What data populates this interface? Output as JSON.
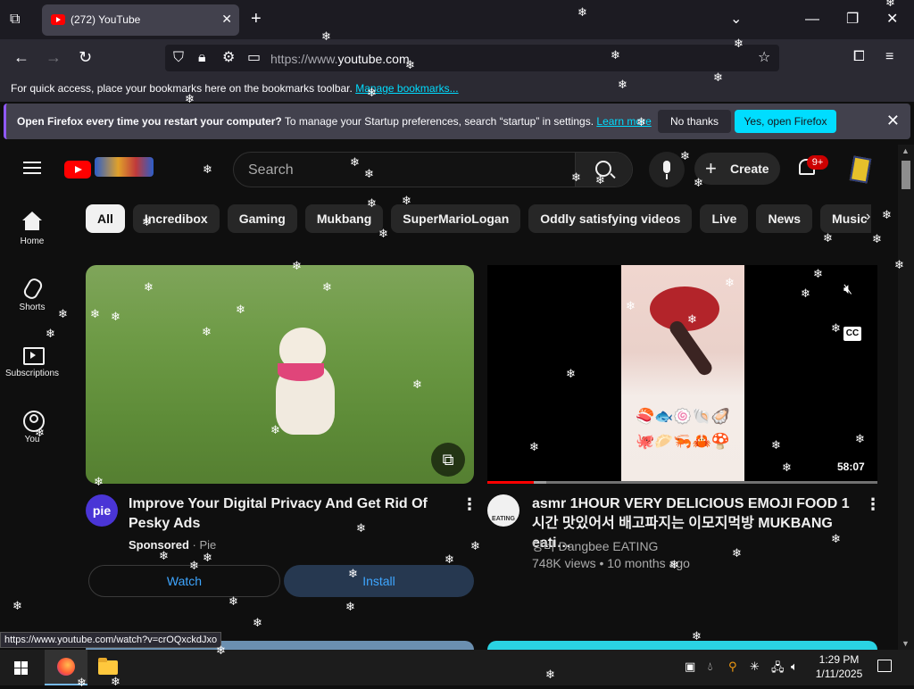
{
  "browser": {
    "tab_title": "(272) YouTube",
    "url_scheme": "https://www.",
    "url_host": "youtube.com",
    "bookmarks_message": "For quick access, place your bookmarks here on the bookmarks toolbar.",
    "manage_bookmarks": "Manage bookmarks...",
    "notification": {
      "bold": "Open Firefox every time you restart your computer?",
      "text": " To manage your Startup preferences, search “startup” in settings.",
      "learn_more": "Learn more",
      "no_thanks": "No thanks",
      "yes_open": "Yes, open Firefox"
    },
    "status_url": "https://www.youtube.com/watch?v=crOQxckdJxo"
  },
  "youtube": {
    "search_placeholder": "Search",
    "create_label": "Create",
    "notification_count": "9+",
    "sidebar": [
      {
        "label": "Home"
      },
      {
        "label": "Shorts"
      },
      {
        "label": "Subscriptions"
      },
      {
        "label": "You"
      }
    ],
    "chips": [
      "All",
      "Incredibox",
      "Gaming",
      "Mukbang",
      "SuperMarioLogan",
      "Oddly satisfying videos",
      "Live",
      "News",
      "Music"
    ],
    "ad": {
      "avatar_text": "pie",
      "title": "Improve Your Digital Privacy And Get Rid Of Pesky Ads",
      "sponsored": "Sponsored",
      "advertiser": "Pie",
      "watch_label": "Watch",
      "install_label": "Install"
    },
    "video": {
      "avatar_text": "EATING",
      "title": "asmr 1HOUR VERY DELICIOUS EMOJI FOOD 1시간 맛있어서 배고파지는 이모지먹방 MUKBANG eati…",
      "channel": "당비 Dangbee EATING",
      "views": "748K views",
      "age": "10 months ago",
      "duration": "58:07",
      "cc_label": "CC",
      "emoji_row1": "🍣🐟🍥🐚🦪",
      "emoji_row2": "🐙🥟🦐🦀🍄",
      "progress_fraction": 0.12,
      "buffered_fraction": 0.15
    }
  },
  "taskbar": {
    "time": "1:29 PM",
    "date": "1/11/2025"
  }
}
